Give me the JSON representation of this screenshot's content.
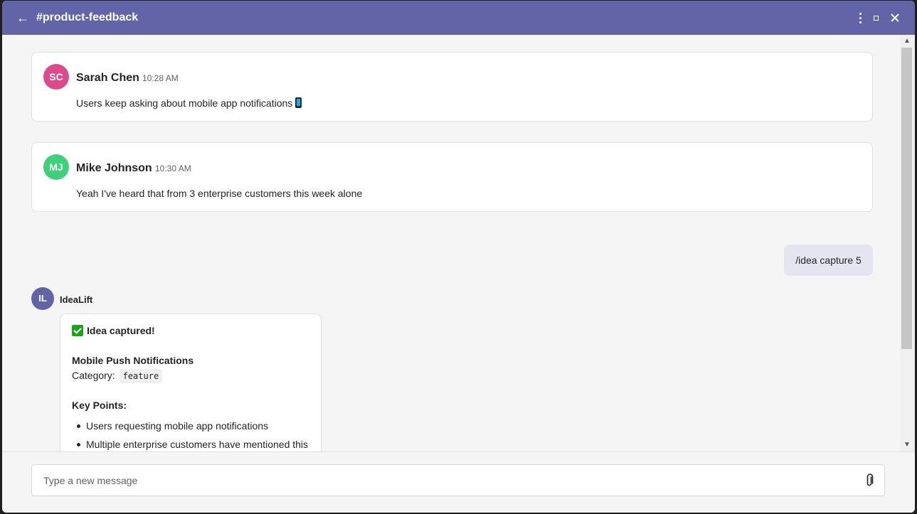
{
  "window": {
    "back_glyph": "←",
    "channel_title": "#product-feedback"
  },
  "messages": [
    {
      "initials": "SC",
      "author": "Sarah Chen",
      "time": "10:28 AM",
      "text": "Users keep asking about mobile app notifications",
      "avatar_color": "#dc4a8c"
    },
    {
      "initials": "MJ",
      "author": "Mike Johnson",
      "time": "10:30 AM",
      "text": "Yeah I've heard that from 3 enterprise customers this week alone",
      "avatar_color": "#3ed07a"
    }
  ],
  "my_message": {
    "text": "/idea capture 5"
  },
  "bot": {
    "initials": "IL",
    "name": "IdeaLift",
    "avatar_color": "#6264a7",
    "card": {
      "heading": "Idea captured!",
      "idea_title": "Mobile Push Notifications",
      "category_label": "Category:",
      "category_value": "feature",
      "key_points_label": "Key Points:",
      "key_points": [
        "Users requesting mobile app notifications",
        "Multiple enterprise customers have mentioned this"
      ]
    }
  },
  "composer": {
    "placeholder": "Type a new message",
    "value": ""
  },
  "colors": {
    "titlebar": "#6264a7",
    "bot_accent": "#6264a7",
    "check": "#1fa31f"
  }
}
